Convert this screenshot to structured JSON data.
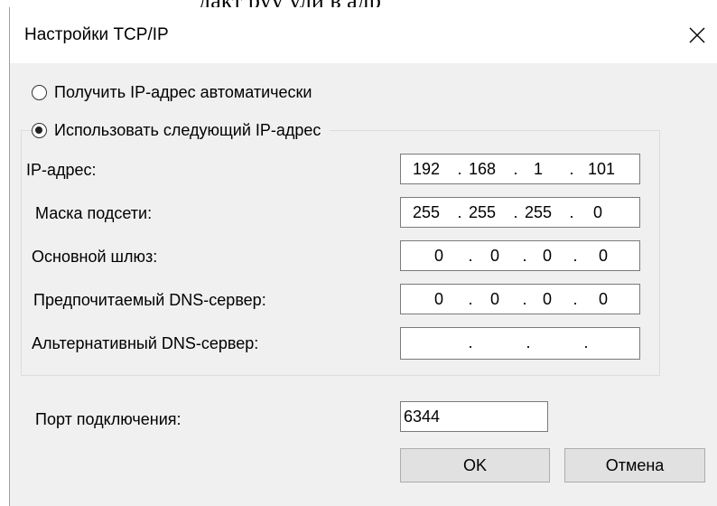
{
  "window": {
    "title": "Настройки TCP/IP",
    "close_icon": "close-icon"
  },
  "cropped_text": "дакт руу ули в адр",
  "radios": [
    {
      "label": "Получить IP-адрес автоматически",
      "checked": false
    },
    {
      "label": "Использовать следующий IP-адрес",
      "checked": true
    }
  ],
  "fields": [
    {
      "label": "IP-адрес:",
      "octets": [
        "192",
        "168",
        "1",
        "101"
      ]
    },
    {
      "label": "Маска подсети:",
      "octets": [
        "255",
        "255",
        "255",
        "0"
      ]
    },
    {
      "label": "Основной шлюз:",
      "octets": [
        "0",
        "0",
        "0",
        "0"
      ]
    },
    {
      "label": "Предпочитаемый DNS-сервер:",
      "octets": [
        "0",
        "0",
        "0",
        "0"
      ]
    },
    {
      "label": "Альтернативный DNS-сервер:",
      "octets": [
        "",
        "",
        "",
        ""
      ]
    }
  ],
  "port": {
    "label": "Порт подключения:",
    "value": "6344"
  },
  "buttons": {
    "ok": "OK",
    "cancel": "Отмена"
  }
}
